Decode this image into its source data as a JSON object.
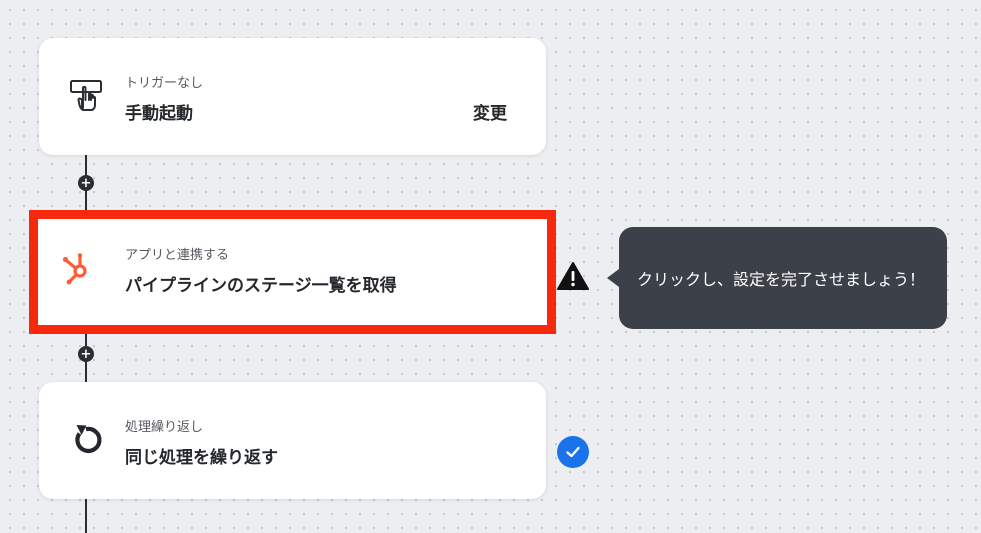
{
  "flow": {
    "steps": [
      {
        "icon": "hand-pointer-icon",
        "subtitle": "トリガーなし",
        "title": "手動起動",
        "action_label": "変更",
        "status": "none"
      },
      {
        "icon": "hubspot-icon",
        "subtitle": "アプリと連携する",
        "title": "パイプラインのステージ一覧を取得",
        "status": "warning",
        "selected": true
      },
      {
        "icon": "loop-icon",
        "subtitle": "処理繰り返し",
        "title": "同じ処理を繰り返す",
        "status": "complete"
      }
    ],
    "add_button_label": "+"
  },
  "tooltip": {
    "text": "クリックし、設定を完了させましょう！"
  },
  "colors": {
    "highlight": "#f7290c",
    "hubspot": "#ff5c35",
    "check": "#1a73e8",
    "tooltip_bg": "#3c4048",
    "warning": "#111111"
  }
}
